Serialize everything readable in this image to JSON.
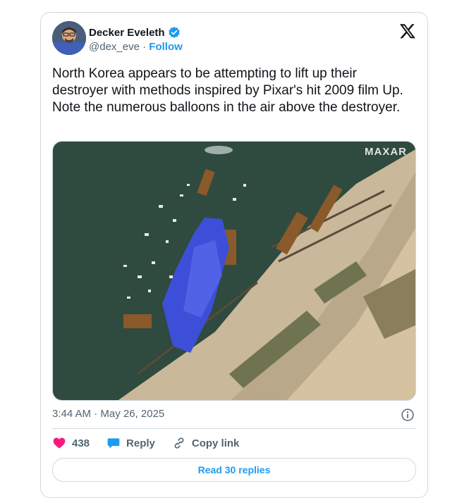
{
  "author": {
    "name": "Decker Eveleth",
    "handle": "@dex_eve",
    "separator": "·",
    "follow_label": "Follow"
  },
  "tweet": {
    "text": "North Korea appears to be attempting to lift up their destroyer with methods inspired by Pixar's hit 2009 film Up. Note the numerous balloons in the air above the destroyer.",
    "media_watermark": "MAXAR",
    "timestamp": "3:44 AM · May 26, 2025"
  },
  "actions": {
    "like_count": "438",
    "reply_label": "Reply",
    "copy_link_label": "Copy link",
    "read_replies_label": "Read 30 replies"
  },
  "colors": {
    "accent": "#1d9bf0",
    "like": "#f91880",
    "water": "#2f4a3e",
    "tarp": "#3d4fd8",
    "sand": "#c9b89a"
  },
  "icons": [
    "verified-badge-icon",
    "x-logo-icon",
    "info-icon",
    "heart-icon",
    "reply-bubble-icon",
    "link-icon"
  ]
}
